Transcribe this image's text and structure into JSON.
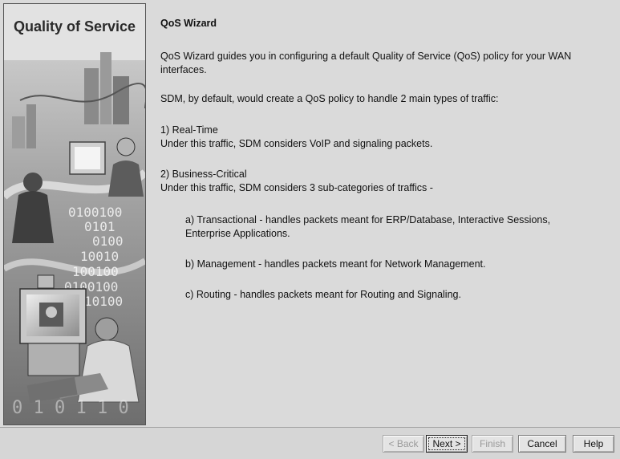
{
  "banner": {
    "title": "Quality of Service",
    "binary_text": [
      "0100100",
      "0101",
      "0100",
      "10010",
      "100100",
      "0100100",
      "10100",
      "0100100"
    ],
    "footer_binary": "0 1 0 1 1 0"
  },
  "wizard": {
    "title": "QoS Wizard",
    "intro": "QoS Wizard guides you in configuring a default Quality of Service (QoS) policy for your WAN interfaces.",
    "default_policy": "SDM, by default, would create a QoS policy to handle 2 main types of traffic:",
    "realtime_heading": "1) Real-Time",
    "realtime_desc": "Under this traffic, SDM considers VoIP and signaling packets.",
    "business_heading": "2) Business-Critical",
    "business_desc": "Under this traffic, SDM considers 3 sub-categories of traffics -",
    "sub_a": "a) Transactional - handles packets meant for ERP/Database, Interactive Sessions, Enterprise Applications.",
    "sub_b": "b) Management - handles packets meant for Network Management.",
    "sub_c": "c) Routing - handles packets meant for Routing and Signaling."
  },
  "buttons": {
    "back": "< Back",
    "next": "Next >",
    "finish": "Finish",
    "cancel": "Cancel",
    "help": "Help"
  },
  "colors": {
    "window_bg": "#dadada",
    "disabled_text": "#9a9a9a"
  }
}
